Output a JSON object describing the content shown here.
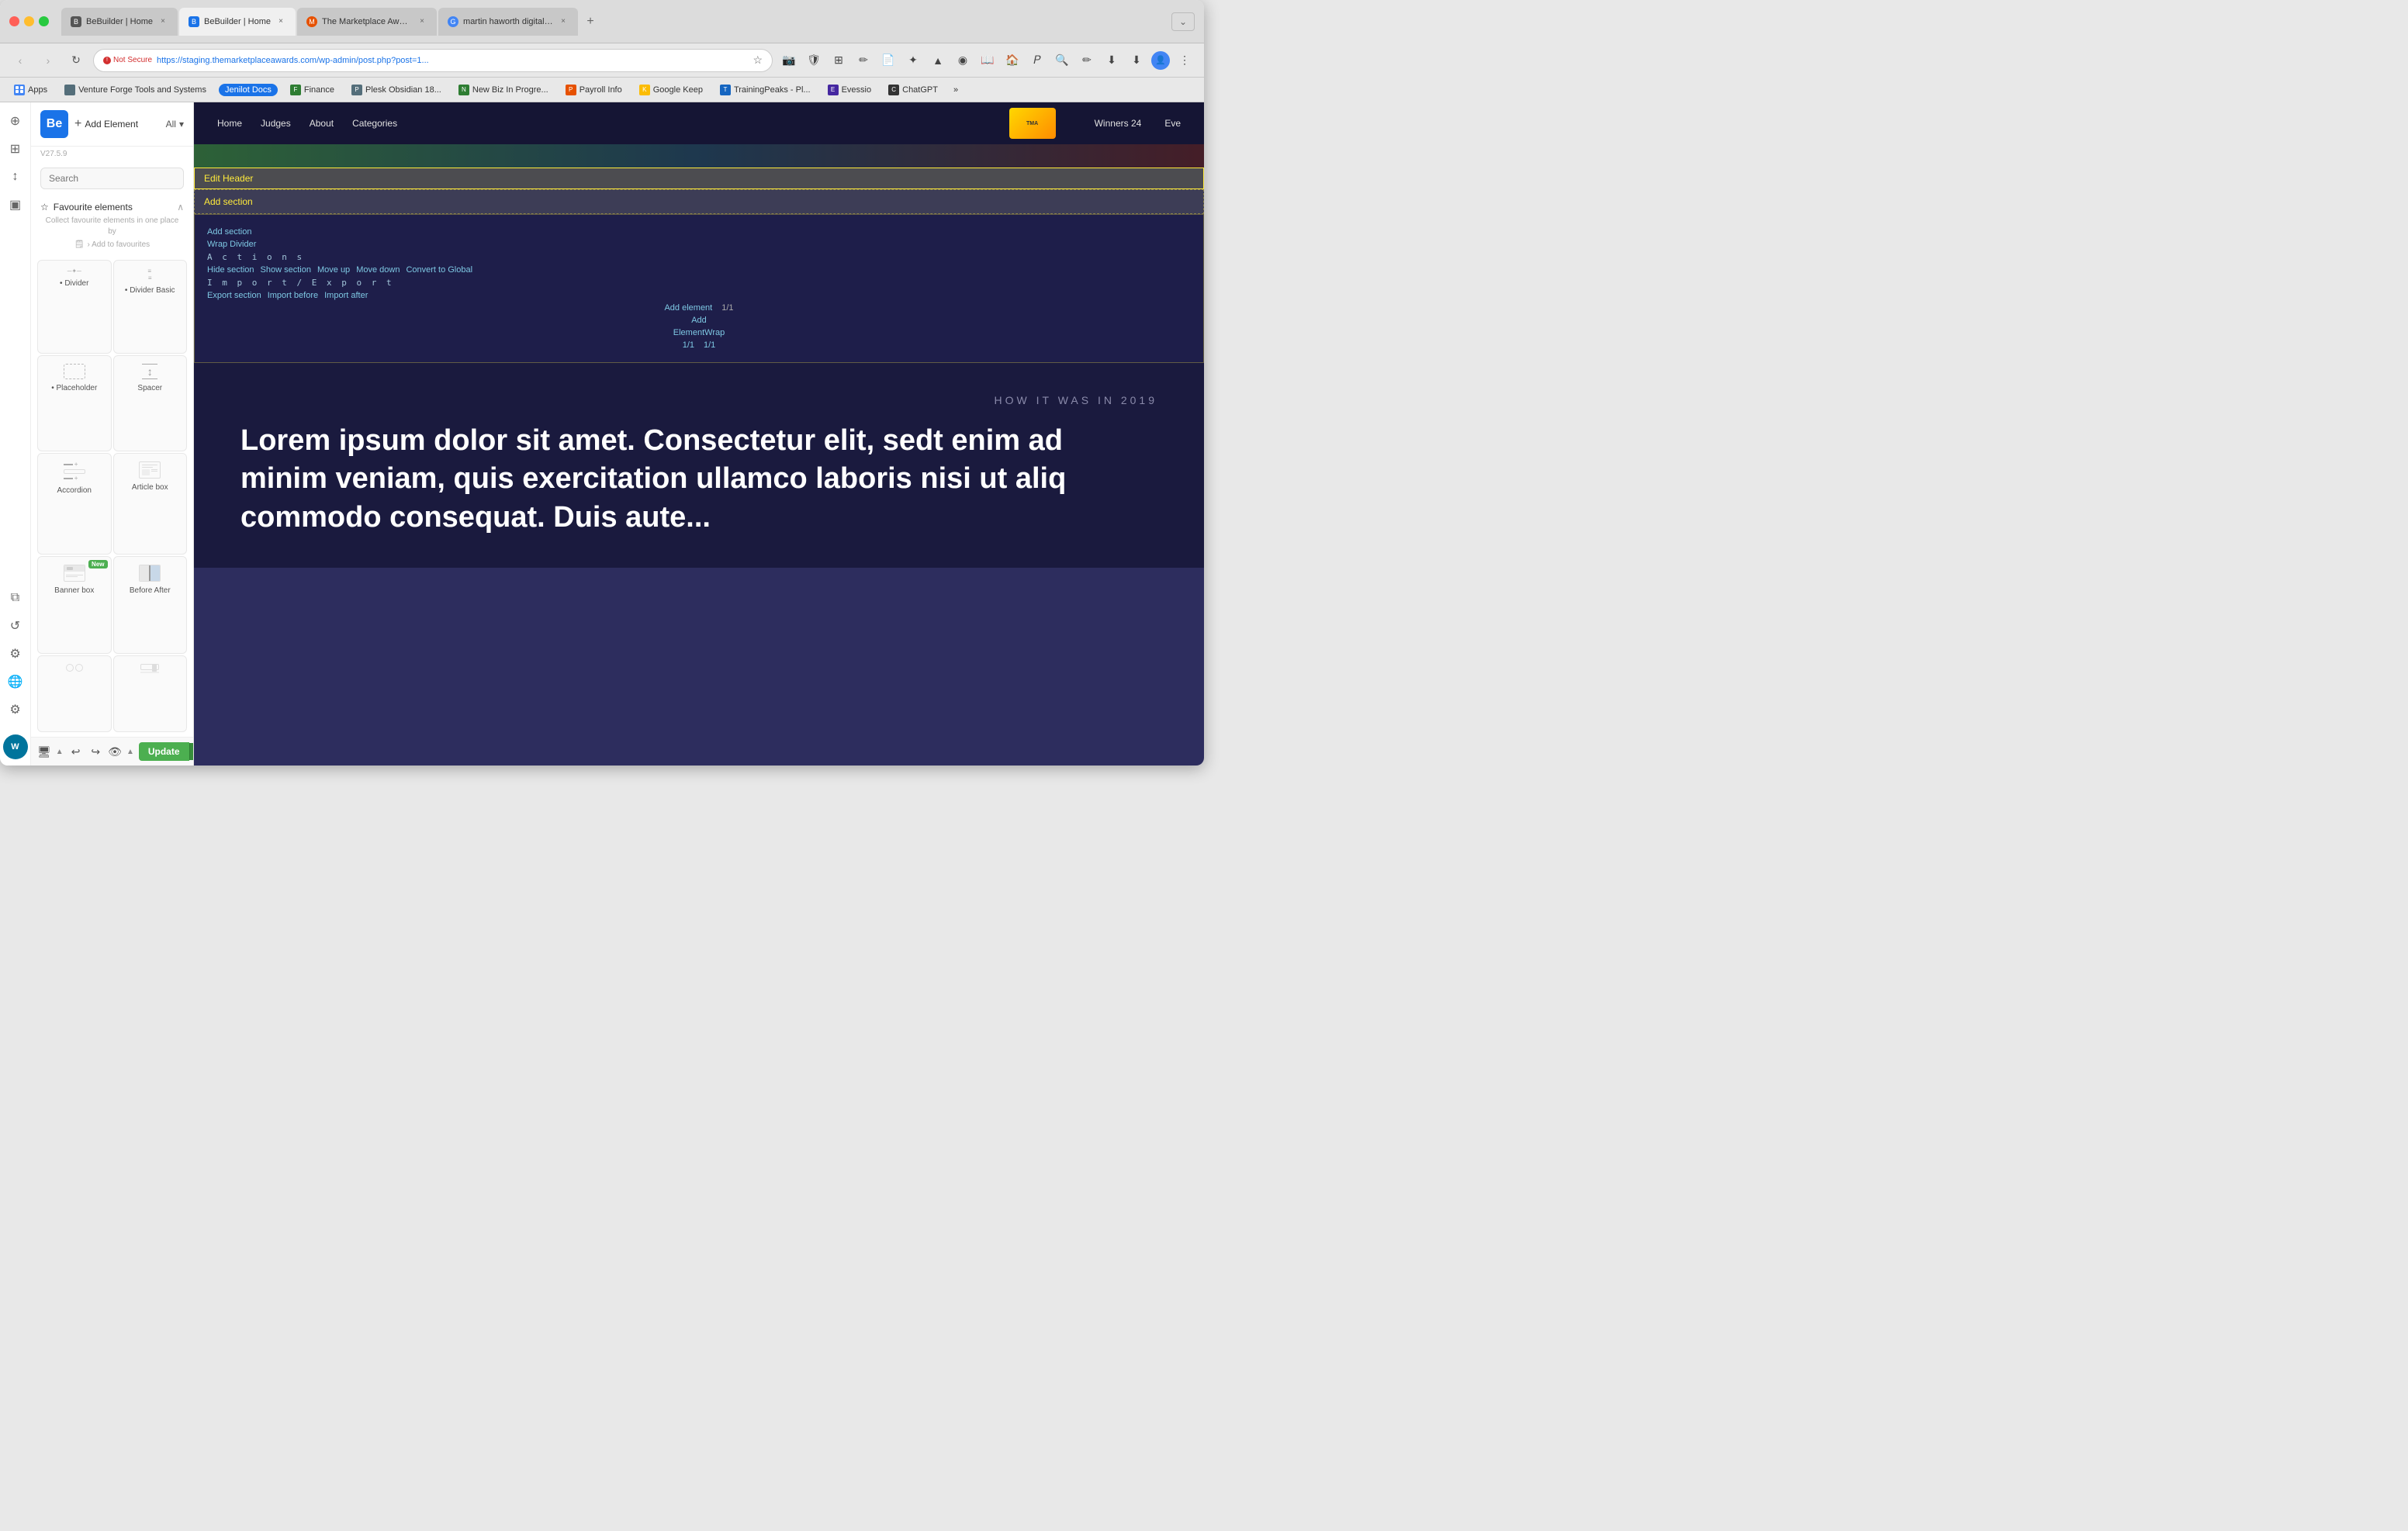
{
  "browser": {
    "tabs": [
      {
        "id": "tab1",
        "favicon_color": "#666",
        "title": "BeBuilder | Home",
        "active": false,
        "close_label": "×"
      },
      {
        "id": "tab2",
        "favicon_color": "#1a73e8",
        "title": "BeBuilder | Home",
        "active": true,
        "close_label": "×"
      },
      {
        "id": "tab3",
        "favicon_color": "#e65100",
        "title": "The Marketplace Awards",
        "active": false,
        "close_label": "×"
      },
      {
        "id": "tab4",
        "favicon_color": "#4285f4",
        "title": "martin haworth digital enterp...",
        "active": false,
        "close_label": "×"
      }
    ],
    "new_tab_label": "+",
    "nav": {
      "back_label": "‹",
      "forward_label": "›",
      "refresh_label": "↻",
      "home_label": "⌂"
    },
    "url_bar": {
      "not_secure_label": "Not Secure",
      "url": "https://staging.themarketplaceawards.com/wp-admin/post.php?post=1..."
    }
  },
  "bookmarks": {
    "apps_label": "Apps",
    "items": [
      {
        "id": "bm1",
        "label": "Venture Forge Tools and Systems",
        "color": "#546e7a"
      },
      {
        "id": "bm2",
        "label": "Jenilot Docs",
        "is_pill": true
      },
      {
        "id": "bm3",
        "label": "Finance",
        "color": "#2e7d32"
      },
      {
        "id": "bm4",
        "label": "Plesk Obsidian 18...",
        "color": "#546e7a"
      },
      {
        "id": "bm5",
        "label": "New Biz In Progre...",
        "color": "#2e7d32"
      },
      {
        "id": "bm6",
        "label": "Payroll Info",
        "color": "#e65100"
      },
      {
        "id": "bm7",
        "label": "Google Keep",
        "color": "#fbbc04"
      },
      {
        "id": "bm8",
        "label": "TrainingPeaks - Pl...",
        "color": "#1565C0"
      },
      {
        "id": "bm9",
        "label": "Evessio",
        "color": "#4527a0"
      },
      {
        "id": "bm10",
        "label": "ChatGPT",
        "color": "#333"
      },
      {
        "id": "bm11",
        "label": "»",
        "is_more": true
      }
    ]
  },
  "sidebar": {
    "logo_label": "Be",
    "add_element_label": "Add Element",
    "all_label": "All",
    "version": "V27.5.9",
    "search_placeholder": "Search",
    "favourites_title": "Favourite elements",
    "favourites_desc": "Collect favourite elements in one place by",
    "add_to_fav_label": "› Add to favourites",
    "elements": [
      {
        "id": "divider",
        "label": "• Divider",
        "icon": "─ ✦ ─"
      },
      {
        "id": "divider-basic",
        "label": "• Divider Basic",
        "icon": "≡"
      },
      {
        "id": "placeholder",
        "label": "• Placeholder",
        "icon": "⬜"
      },
      {
        "id": "spacer",
        "label": "Spacer",
        "icon": "↕"
      },
      {
        "id": "accordion",
        "label": "Accordion",
        "icon": "☰"
      },
      {
        "id": "article-box",
        "label": "Article box",
        "icon": "📄"
      },
      {
        "id": "banner-box",
        "label": "Banner box",
        "icon": "▤",
        "is_new": true
      },
      {
        "id": "before-after",
        "label": "Before After",
        "icon": "⊣"
      }
    ],
    "bottom_bar": {
      "screen_icon": "🖥",
      "undo_label": "↩",
      "redo_label": "↪",
      "eye_label": "👁",
      "update_label": "Update",
      "update_arrow": "▲"
    }
  },
  "icon_strip": {
    "icons": [
      {
        "id": "add-icon",
        "symbol": "⊕"
      },
      {
        "id": "grid-icon",
        "symbol": "⊞"
      },
      {
        "id": "sort-icon",
        "symbol": "↕"
      },
      {
        "id": "layout-icon",
        "symbol": "▣"
      },
      {
        "id": "layers-icon",
        "symbol": "⧉"
      },
      {
        "id": "history-icon",
        "symbol": "↺"
      },
      {
        "id": "filter-icon",
        "symbol": "⚙"
      },
      {
        "id": "globe-icon",
        "symbol": "🌐"
      },
      {
        "id": "settings-icon",
        "symbol": "⚙"
      },
      {
        "id": "wp-icon",
        "symbol": "W"
      }
    ]
  },
  "page": {
    "nav": {
      "links": [
        "Home",
        "Judges",
        "About",
        "Categories"
      ],
      "logo_text": "TMA",
      "winners_label": "Winners 24",
      "eve_label": "Eve"
    },
    "edit_header_label": "Edit Header",
    "add_section_label": "Add section",
    "section_controls": {
      "add_section": "Add section",
      "wrap_divider": "Wrap Divider",
      "actions_label": "A c t i o n s",
      "hide_section": "Hide section",
      "show_section": "Show section",
      "move_up": "Move up",
      "move_down": "Move down",
      "convert_to_global": "Convert to Global",
      "import_export": "I m p o r t / E x p o r t",
      "export_section": "Export section",
      "import_before": "Import before",
      "import_after": "Import after",
      "add_element": "Add element",
      "path1": "1/1",
      "add_label": "Add",
      "element_wrap": "ElementWrap",
      "path2": "1/1",
      "path3": "1/1"
    },
    "content": {
      "how_it_was": "HOW IT WAS IN 2019",
      "lorem_text": "Lorem ipsum dolor sit amet. Consectetur elit, sedt enim ad minim veniam, quis exercitation ullamco laboris nisi ut aliq commodo consequat. Duis aute..."
    }
  }
}
